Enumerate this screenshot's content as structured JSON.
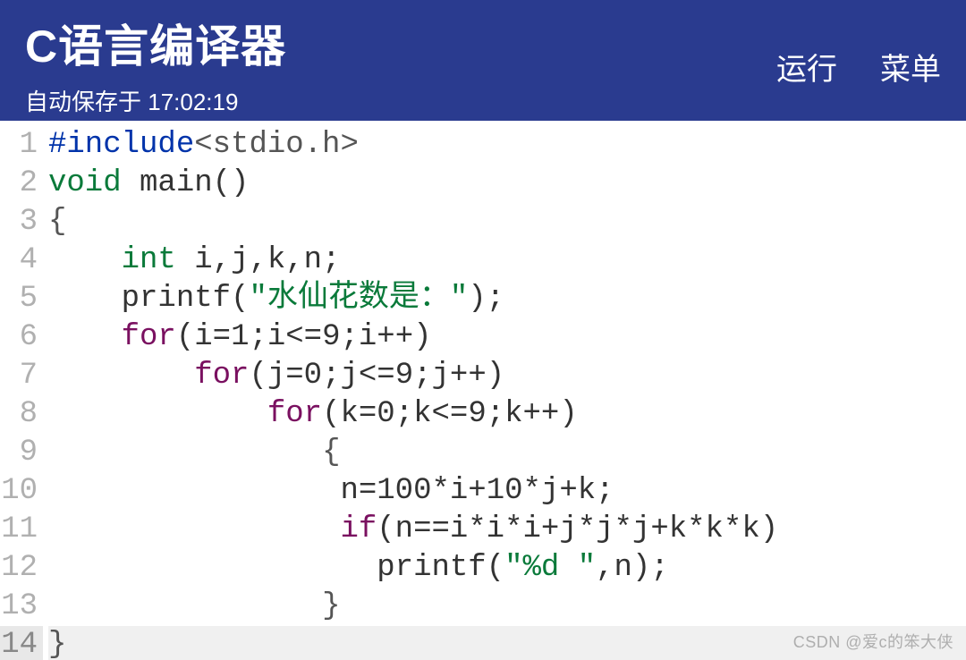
{
  "header": {
    "title": "C语言编译器",
    "autosave_prefix": "自动保存于 ",
    "autosave_time": "17:02:19",
    "run_label": "运行",
    "menu_label": "菜单"
  },
  "editor": {
    "current_line": 14,
    "lines": [
      {
        "num": 1,
        "tokens": [
          {
            "cls": "tk-preproc",
            "text": "#include"
          },
          {
            "cls": "tk-header",
            "text": "<stdio.h>"
          }
        ]
      },
      {
        "num": 2,
        "tokens": [
          {
            "cls": "tk-keyword",
            "text": "void"
          },
          {
            "cls": "tk-ident",
            "text": " main()"
          }
        ]
      },
      {
        "num": 3,
        "tokens": [
          {
            "cls": "tk-punc",
            "text": "{"
          }
        ]
      },
      {
        "num": 4,
        "tokens": [
          {
            "cls": "",
            "text": "    "
          },
          {
            "cls": "tk-keyword",
            "text": "int"
          },
          {
            "cls": "tk-ident",
            "text": " i,j,k,n;"
          }
        ]
      },
      {
        "num": 5,
        "tokens": [
          {
            "cls": "",
            "text": "    "
          },
          {
            "cls": "tk-ident",
            "text": "printf("
          },
          {
            "cls": "tk-string",
            "text": "\"水仙花数是：\""
          },
          {
            "cls": "tk-ident",
            "text": ");"
          }
        ]
      },
      {
        "num": 6,
        "tokens": [
          {
            "cls": "",
            "text": "    "
          },
          {
            "cls": "tk-type",
            "text": "for"
          },
          {
            "cls": "tk-ident",
            "text": "(i="
          },
          {
            "cls": "tk-num",
            "text": "1"
          },
          {
            "cls": "tk-ident",
            "text": ";i<="
          },
          {
            "cls": "tk-num",
            "text": "9"
          },
          {
            "cls": "tk-ident",
            "text": ";i++)"
          }
        ]
      },
      {
        "num": 7,
        "tokens": [
          {
            "cls": "",
            "text": "        "
          },
          {
            "cls": "tk-type",
            "text": "for"
          },
          {
            "cls": "tk-ident",
            "text": "(j="
          },
          {
            "cls": "tk-num",
            "text": "0"
          },
          {
            "cls": "tk-ident",
            "text": ";j<="
          },
          {
            "cls": "tk-num",
            "text": "9"
          },
          {
            "cls": "tk-ident",
            "text": ";j++)"
          }
        ]
      },
      {
        "num": 8,
        "tokens": [
          {
            "cls": "",
            "text": "            "
          },
          {
            "cls": "tk-type",
            "text": "for"
          },
          {
            "cls": "tk-ident",
            "text": "(k="
          },
          {
            "cls": "tk-num",
            "text": "0"
          },
          {
            "cls": "tk-ident",
            "text": ";k<="
          },
          {
            "cls": "tk-num",
            "text": "9"
          },
          {
            "cls": "tk-ident",
            "text": ";k++)"
          }
        ]
      },
      {
        "num": 9,
        "tokens": [
          {
            "cls": "",
            "text": "               "
          },
          {
            "cls": "tk-punc",
            "text": "{"
          }
        ]
      },
      {
        "num": 10,
        "tokens": [
          {
            "cls": "",
            "text": "                "
          },
          {
            "cls": "tk-ident",
            "text": "n="
          },
          {
            "cls": "tk-num",
            "text": "100"
          },
          {
            "cls": "tk-ident",
            "text": "*i+"
          },
          {
            "cls": "tk-num",
            "text": "10"
          },
          {
            "cls": "tk-ident",
            "text": "*j+k;"
          }
        ]
      },
      {
        "num": 11,
        "tokens": [
          {
            "cls": "",
            "text": "                "
          },
          {
            "cls": "tk-type",
            "text": "if"
          },
          {
            "cls": "tk-ident",
            "text": "(n==i*i*i+j*j*j+k*k*k)"
          }
        ]
      },
      {
        "num": 12,
        "tokens": [
          {
            "cls": "",
            "text": "                  "
          },
          {
            "cls": "tk-ident",
            "text": "printf("
          },
          {
            "cls": "tk-string",
            "text": "\"%d \""
          },
          {
            "cls": "tk-ident",
            "text": ",n);"
          }
        ]
      },
      {
        "num": 13,
        "tokens": [
          {
            "cls": "",
            "text": "               "
          },
          {
            "cls": "tk-punc",
            "text": "}"
          }
        ]
      },
      {
        "num": 14,
        "tokens": [
          {
            "cls": "tk-punc",
            "text": "}"
          }
        ]
      }
    ]
  },
  "watermark": "CSDN @爱c的笨大侠"
}
